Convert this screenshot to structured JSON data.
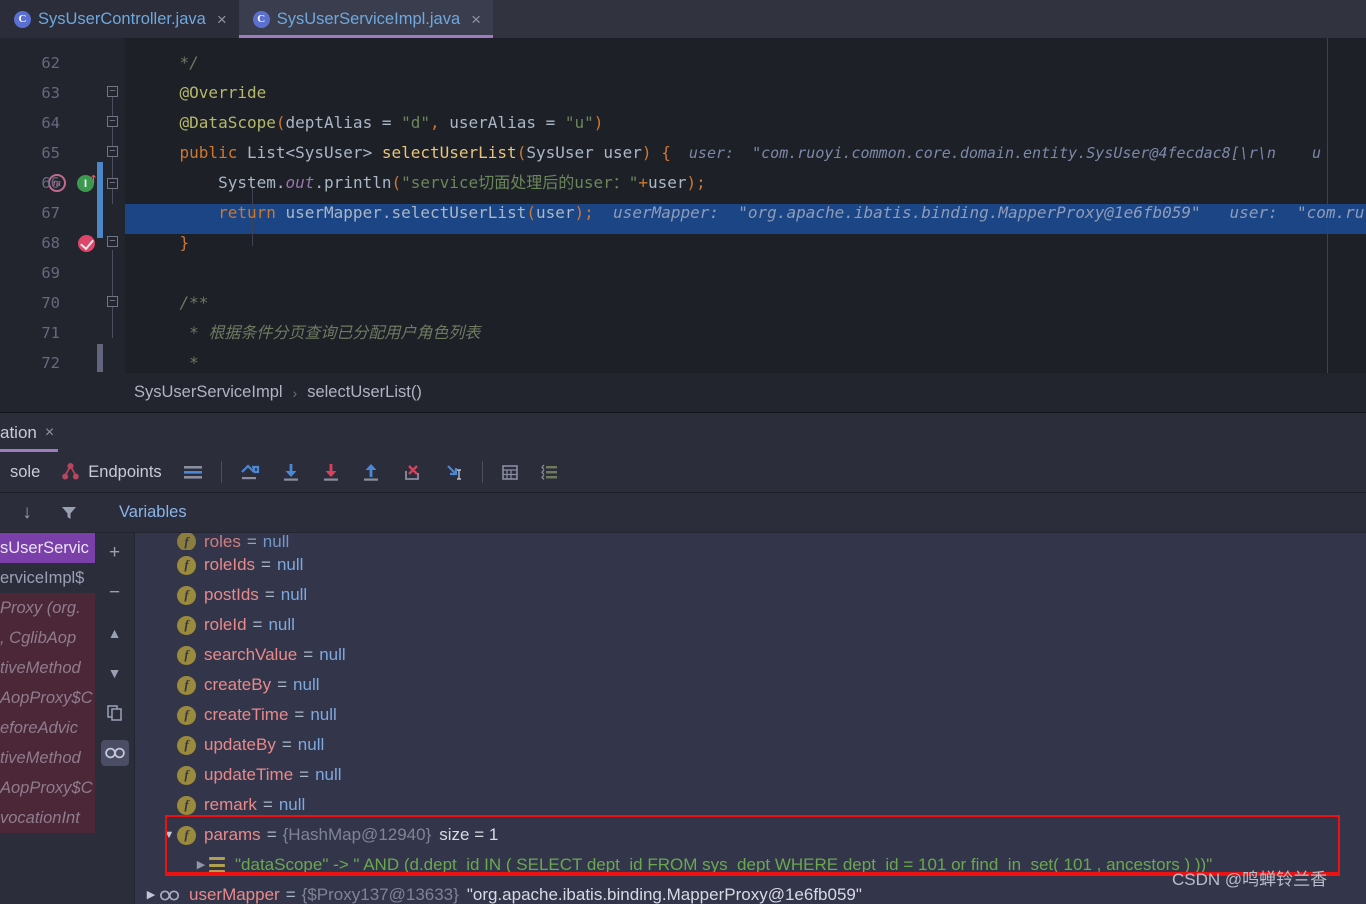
{
  "editor_tabs": [
    {
      "label": "SysUserController.java",
      "icon": "class-icon",
      "icon_letter": "C",
      "active": false,
      "close": "×"
    },
    {
      "label": "SysUserServiceImpl.java",
      "icon": "class-icon",
      "icon_letter": "C",
      "active": true,
      "close": "×"
    }
  ],
  "editor": {
    "lines": [
      {
        "num": "62",
        "segments": [
          {
            "t": "    */",
            "c": "cmt"
          }
        ]
      },
      {
        "num": "63",
        "segments": [
          {
            "t": "    @Override",
            "c": "anno"
          }
        ]
      },
      {
        "num": "64",
        "segments": [
          {
            "t": "    @DataScope",
            "c": "anno"
          },
          {
            "t": "(",
            "c": "punc"
          },
          {
            "t": "deptAlias ",
            "c": "plain"
          },
          {
            "t": "= ",
            "c": "plain"
          },
          {
            "t": "\"d\"",
            "c": "str"
          },
          {
            "t": ", ",
            "c": "punc"
          },
          {
            "t": "userAlias ",
            "c": "plain"
          },
          {
            "t": "= ",
            "c": "plain"
          },
          {
            "t": "\"u\"",
            "c": "str"
          },
          {
            "t": ")",
            "c": "punc"
          }
        ]
      },
      {
        "num": "65",
        "segments": [
          {
            "t": "    public ",
            "c": "kw"
          },
          {
            "t": "List<SysUser> ",
            "c": "plain"
          },
          {
            "t": "selectUserList",
            "c": "fn"
          },
          {
            "t": "(",
            "c": "punc"
          },
          {
            "t": "SysUser user",
            "c": "plain"
          },
          {
            "t": ") {",
            "c": "punc"
          }
        ],
        "hint": "  user:  \"com.ruoyi.common.core.domain.entity.SysUser@4fecdac8[\\r\\n    u"
      },
      {
        "num": "66",
        "segments": [
          {
            "t": "        System.",
            "c": "plain"
          },
          {
            "t": "out",
            "c": "fld"
          },
          {
            "t": ".",
            "c": "plain"
          },
          {
            "t": "println",
            "c": "plain"
          },
          {
            "t": "(",
            "c": "punc"
          },
          {
            "t": "\"service切面处理后的user：\"",
            "c": "str"
          },
          {
            "t": "+",
            "c": "punc"
          },
          {
            "t": "user",
            "c": "plain"
          },
          {
            "t": ");",
            "c": "punc"
          }
        ]
      },
      {
        "num": "67",
        "segments": [
          {
            "t": "        return ",
            "c": "kw"
          },
          {
            "t": "userMapper",
            "c": "plain"
          },
          {
            "t": ".",
            "c": "plain"
          },
          {
            "t": "selectUserList",
            "c": "plain"
          },
          {
            "t": "(",
            "c": "punc"
          },
          {
            "t": "user",
            "c": "plain"
          },
          {
            "t": ")",
            "c": "punc"
          },
          {
            "t": ";",
            "c": "punc"
          }
        ],
        "hint": "  userMapper:  \"org.apache.ibatis.binding.MapperProxy@1e6fb059\"   user:  \"com.ru",
        "executing": true
      },
      {
        "num": "68",
        "segments": [
          {
            "t": "    }",
            "c": "punc"
          }
        ]
      },
      {
        "num": "69",
        "segments": []
      },
      {
        "num": "70",
        "segments": [
          {
            "t": "    /**",
            "c": "cmt"
          }
        ]
      },
      {
        "num": "71",
        "segments": [
          {
            "t": "     * 根据条件分页查询已分配用户角色列表",
            "c": "cmtz"
          }
        ]
      },
      {
        "num": "72",
        "segments": [
          {
            "t": "     *",
            "c": "cmt"
          }
        ]
      }
    ],
    "gutter": {
      "override_icon": "override-method-icon",
      "override_glyph": "m",
      "implemented_icon": "implemented-interface-icon",
      "implemented_glyph": "I",
      "breakpoint_icon": "breakpoint-verified-icon"
    }
  },
  "breadcrumb": {
    "class": "SysUserServiceImpl",
    "separator": "›",
    "method": "selectUserList()"
  },
  "toolwindow": {
    "tab_label": "ation",
    "tab_close": "×",
    "console_tab": "sole",
    "endpoints_tab": "Endpoints",
    "buttons": [
      {
        "name": "show-execution-point-button",
        "icon": "execution-point-icon"
      },
      {
        "name": "step-over-button",
        "icon": "step-over-icon"
      },
      {
        "name": "step-into-button",
        "icon": "step-into-icon"
      },
      {
        "name": "force-step-into-button",
        "icon": "force-step-into-icon"
      },
      {
        "name": "step-out-button",
        "icon": "step-out-icon"
      },
      {
        "name": "drop-frame-button",
        "icon": "drop-frame-icon"
      },
      {
        "name": "run-to-cursor-button",
        "icon": "run-to-cursor-icon"
      },
      {
        "name": "evaluate-expression-button",
        "icon": "evaluate-expression-icon"
      },
      {
        "name": "settings-button",
        "icon": "debugger-settings-icon"
      }
    ]
  },
  "frames": {
    "toolbar": [
      {
        "name": "export-threads-button",
        "icon": "down-arrow-icon",
        "glyph": "↓"
      },
      {
        "name": "filter-frames-button",
        "icon": "filter-icon",
        "glyph": "▼"
      }
    ],
    "rows": [
      {
        "text": "sUserServic",
        "style": "sel"
      },
      {
        "text": "erviceImpl$",
        "style": "normal"
      },
      {
        "text": "Proxy (org.",
        "style": "lib"
      },
      {
        "text": ", CglibAop",
        "style": "lib"
      },
      {
        "text": "tiveMethod",
        "style": "lib"
      },
      {
        "text": "AopProxy$C",
        "style": "lib"
      },
      {
        "text": "eforeAdvic",
        "style": "lib"
      },
      {
        "text": "tiveMethod",
        "style": "lib"
      },
      {
        "text": "AopProxy$C",
        "style": "lib"
      },
      {
        "text": "vocationInt",
        "style": "lib"
      }
    ]
  },
  "minibar": [
    {
      "name": "add-watch-button",
      "icon": "plus-icon",
      "glyph": "+"
    },
    {
      "name": "remove-watch-button",
      "icon": "minus-icon",
      "glyph": "−"
    },
    {
      "name": "move-watch-up-button",
      "icon": "arrow-up-icon",
      "glyph": "▲"
    },
    {
      "name": "move-watch-down-button",
      "icon": "arrow-down-icon",
      "glyph": "▼"
    },
    {
      "name": "copy-value-button",
      "icon": "copy-icon",
      "glyph": "❐"
    },
    {
      "name": "watches-in-variables-button",
      "icon": "glasses-icon",
      "glyph": "∞",
      "active": true
    }
  ],
  "variables": {
    "header": "Variables",
    "rows": [
      {
        "clipped": true,
        "icon": "field-icon",
        "indent": 1,
        "name": "roles",
        "value": "null",
        "value_type": "null"
      },
      {
        "icon": "field-icon",
        "indent": 1,
        "name": "roleIds",
        "value": "null",
        "value_type": "null"
      },
      {
        "icon": "field-icon",
        "indent": 1,
        "name": "postIds",
        "value": "null",
        "value_type": "null"
      },
      {
        "icon": "field-icon",
        "indent": 1,
        "name": "roleId",
        "value": "null",
        "value_type": "null"
      },
      {
        "icon": "field-icon",
        "indent": 1,
        "name": "searchValue",
        "value": "null",
        "value_type": "null"
      },
      {
        "icon": "field-icon",
        "indent": 1,
        "name": "createBy",
        "value": "null",
        "value_type": "null"
      },
      {
        "icon": "field-icon",
        "indent": 1,
        "name": "createTime",
        "value": "null",
        "value_type": "null"
      },
      {
        "icon": "field-icon",
        "indent": 1,
        "name": "updateBy",
        "value": "null",
        "value_type": "null"
      },
      {
        "icon": "field-icon",
        "indent": 1,
        "name": "updateTime",
        "value": "null",
        "value_type": "null"
      },
      {
        "icon": "field-icon",
        "indent": 1,
        "name": "remark",
        "value": "null",
        "value_type": "null"
      },
      {
        "icon": "field-icon",
        "indent": 1,
        "expanded": true,
        "toggle": "▼",
        "name": "params",
        "ref": "{HashMap@12940}",
        "size": "size = 1",
        "value_type": "object"
      },
      {
        "icon": "map-entry-icon",
        "indent": 2,
        "expanded": false,
        "toggle": "▶",
        "key": "\"dataScope\"",
        "arrow": "->",
        "string_value": "\" AND (d.dept_id IN ( SELECT dept_id FROM sys_dept WHERE dept_id = 101 or find_in_set( 101 , ancestors ) ))\"",
        "value_type": "string"
      },
      {
        "icon": "object-icon",
        "indent": 0,
        "toggle": "▶",
        "name": "userMapper",
        "ref": "{$Proxy137@13633}",
        "string_value": "\"org.apache.ibatis.binding.MapperProxy@1e6fb059\"",
        "value_type": "proxy"
      }
    ]
  },
  "annotation": {
    "highlight_color": "#ee1111"
  },
  "watermark": "CSDN @鸣蝉铃兰香"
}
